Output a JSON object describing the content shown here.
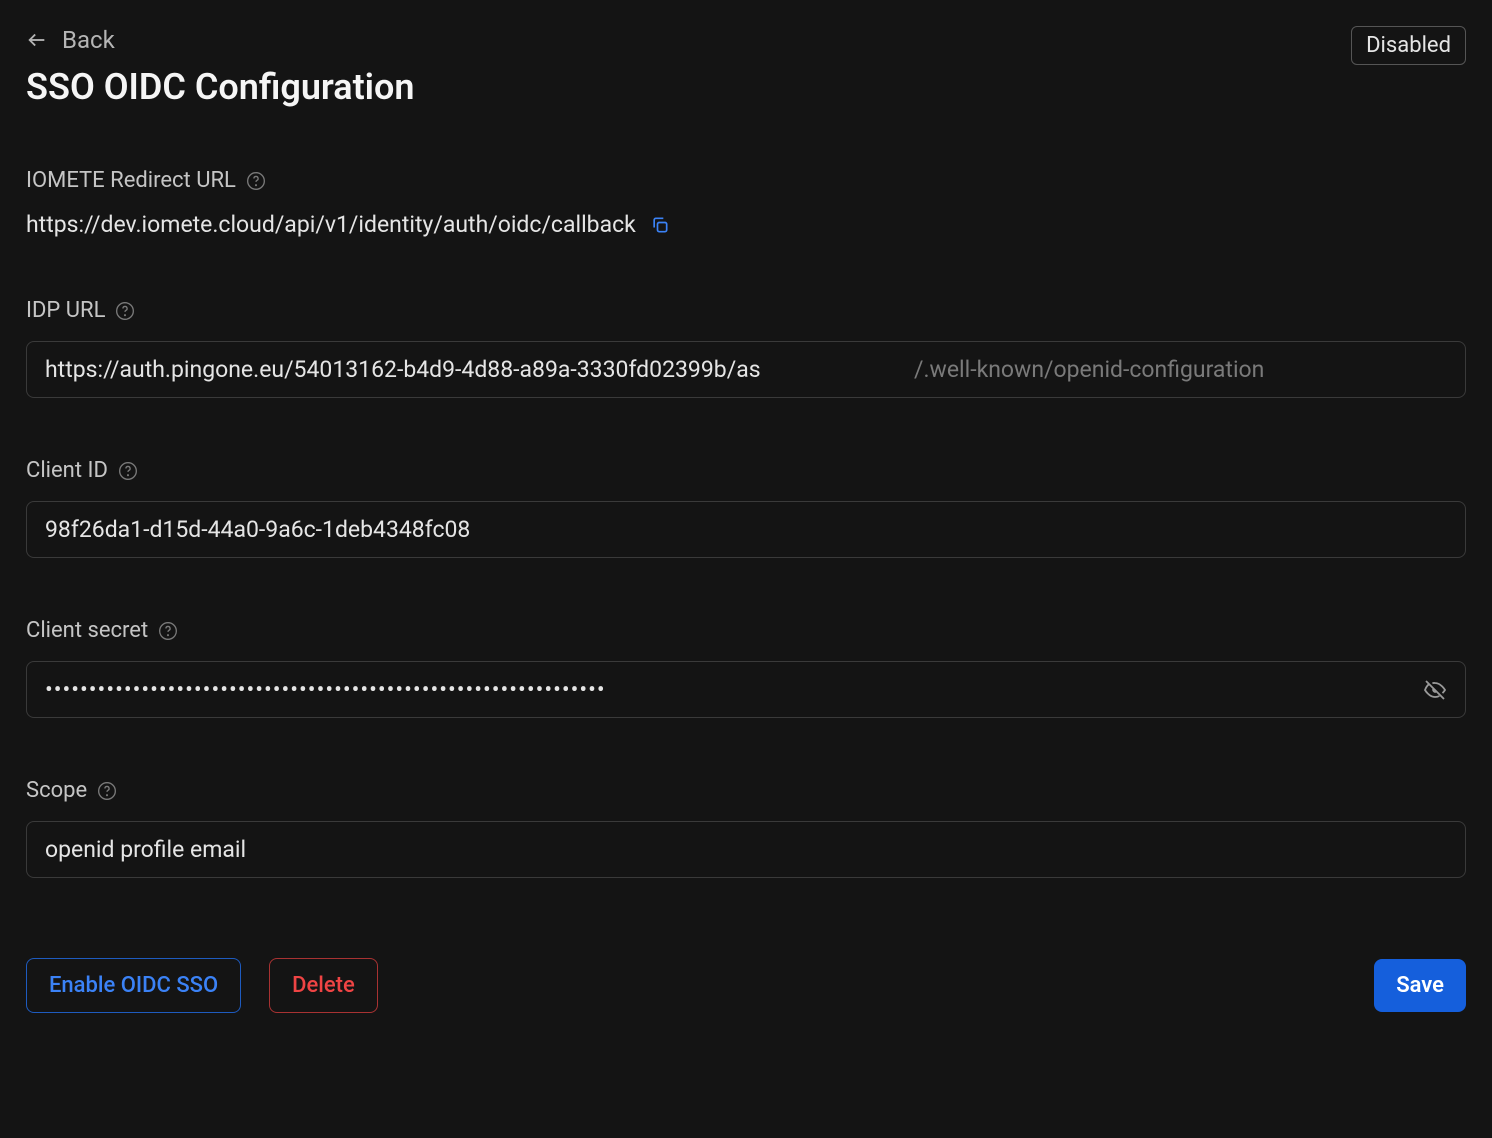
{
  "header": {
    "back_label": "Back",
    "title": "SSO OIDC Configuration",
    "status_badge": "Disabled"
  },
  "redirect": {
    "label": "IOMETE Redirect URL",
    "value": "https://dev.iomete.cloud/api/v1/identity/auth/oidc/callback"
  },
  "idp_url": {
    "label": "IDP URL",
    "value": "https://auth.pingone.eu/54013162-b4d9-4d88-a89a-3330fd02399b/as",
    "suffix": "/.well-known/openid-configuration"
  },
  "client_id": {
    "label": "Client ID",
    "value": "98f26da1-d15d-44a0-9a6c-1deb4348fc08"
  },
  "client_secret": {
    "label": "Client secret",
    "value": "••••••••••••••••••••••••••••••••••••••••••••••••••••••••••••••••"
  },
  "scope": {
    "label": "Scope",
    "value": "openid profile email"
  },
  "actions": {
    "enable": "Enable OIDC SSO",
    "delete": "Delete",
    "save": "Save"
  }
}
